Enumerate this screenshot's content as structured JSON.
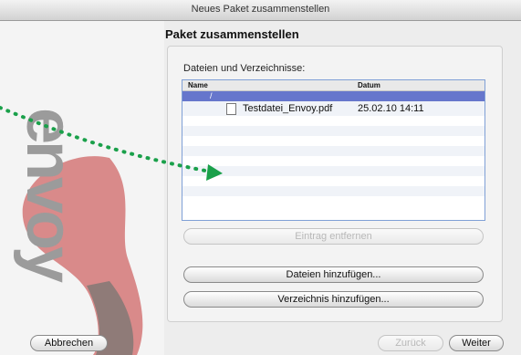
{
  "window": {
    "title": "Neues Paket zusammenstellen"
  },
  "brand": {
    "text": "envoy"
  },
  "page": {
    "heading": "Paket zusammenstellen"
  },
  "files": {
    "label": "Dateien und Verzeichnisse:",
    "columns": [
      "Name",
      "Datum"
    ],
    "root_entry": "/",
    "items": [
      {
        "name": "Testdatei_Envoy.pdf",
        "date": "25.02.10 14:11"
      }
    ]
  },
  "buttons": {
    "remove": "Eintrag entfernen",
    "add_files": "Dateien hinzufügen...",
    "add_folder": "Verzeichnis hinzufügen...",
    "cancel": "Abbrechen",
    "back": "Zurück",
    "next": "Weiter"
  },
  "colors": {
    "accent": "#1aa04a",
    "logo_red": "#d98a8a",
    "selection": "#6676cc"
  }
}
